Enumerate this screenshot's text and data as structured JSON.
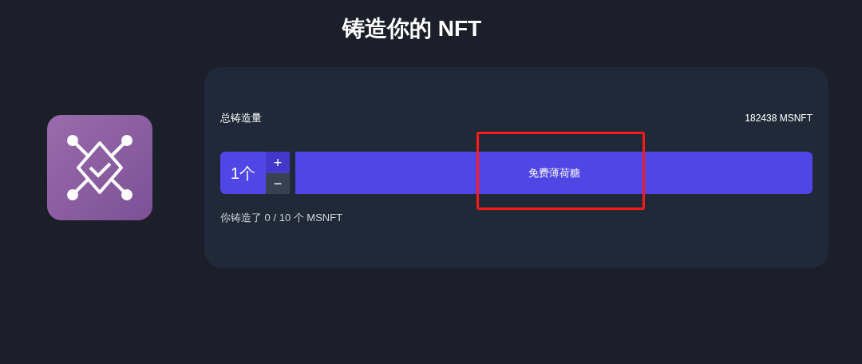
{
  "title": "铸造你的 NFT",
  "summary": {
    "label": "总铸造量",
    "value": "182438 MSNFT"
  },
  "quantity": {
    "value": "1个",
    "increment": "+",
    "decrement": "−"
  },
  "mint_button": {
    "label": "免费薄荷糖",
    "highlighted": true
  },
  "minted_note": "你铸造了 0 / 10 个 MSNFT"
}
